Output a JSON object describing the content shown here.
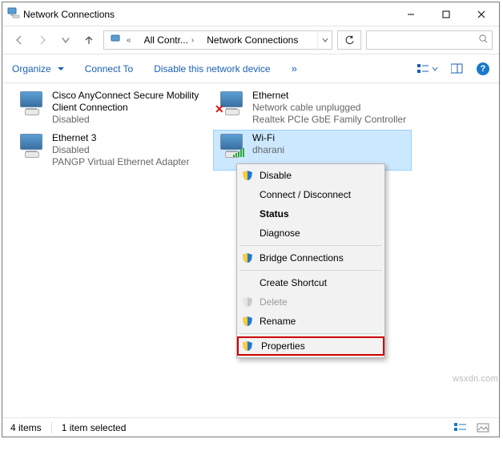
{
  "titlebar": {
    "title": "Network Connections"
  },
  "addressbar": {
    "crumb1": "All Contr...",
    "crumb2": "Network Connections"
  },
  "toolbar": {
    "organize": "Organize",
    "connect_to": "Connect To",
    "disable": "Disable this network device",
    "chevrons": "»"
  },
  "items": [
    {
      "name": "Cisco AnyConnect Secure Mobility Client Connection",
      "status": "Disabled",
      "device": ""
    },
    {
      "name": "Ethernet",
      "status": "Network cable unplugged",
      "device": "Realtek PCIe GbE Family Controller"
    },
    {
      "name": "Ethernet 3",
      "status": "Disabled",
      "device": "PANGP Virtual Ethernet Adapter"
    },
    {
      "name": "Wi-Fi",
      "status": "dharani",
      "device": ""
    }
  ],
  "contextmenu": {
    "disable": "Disable",
    "connect": "Connect / Disconnect",
    "status": "Status",
    "diagnose": "Diagnose",
    "bridge": "Bridge Connections",
    "shortcut": "Create Shortcut",
    "delete": "Delete",
    "rename": "Rename",
    "properties": "Properties"
  },
  "statusbar": {
    "count": "4 items",
    "selected": "1 item selected"
  },
  "watermark": "wsxdn.com"
}
